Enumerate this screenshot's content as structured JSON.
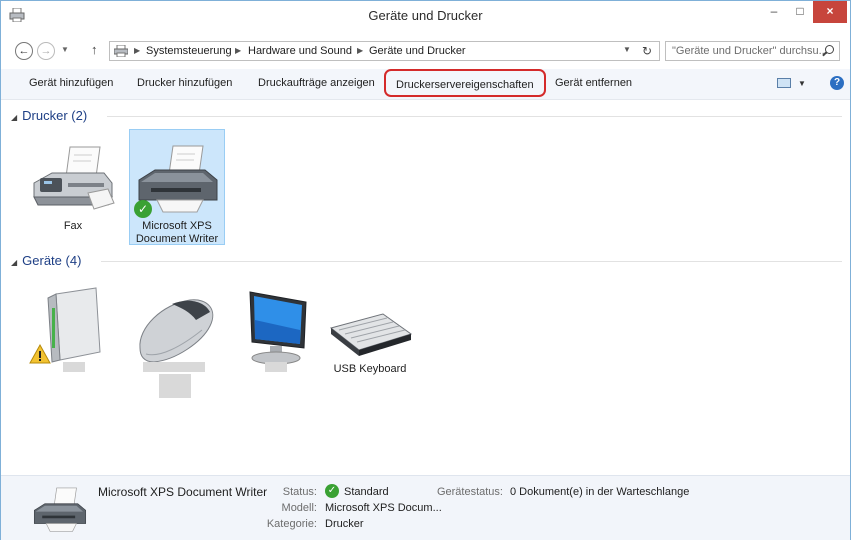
{
  "window": {
    "title": "Geräte und Drucker",
    "minimize": "–",
    "maximize": "□",
    "close": "×"
  },
  "address": {
    "back": "←",
    "forward": "→",
    "up": "↑",
    "breadcrumbs": [
      "Systemsteuerung",
      "Hardware und Sound",
      "Geräte und Drucker"
    ],
    "refresh": "↻",
    "search_placeholder": "\"Geräte und Drucker\" durchsu..."
  },
  "commands": {
    "add_device": "Gerät hinzufügen",
    "add_printer": "Drucker hinzufügen",
    "print_jobs": "Druckaufträge anzeigen",
    "server_properties": "Druckerservereigenschaften",
    "remove_device": "Gerät entfernen",
    "help": "?"
  },
  "groups": {
    "printers_header": "Drucker (2)",
    "devices_header": "Geräte (4)"
  },
  "printers": [
    {
      "label": "Fax"
    },
    {
      "label_line1": "Microsoft XPS",
      "label_line2": "Document Writer",
      "default": true
    }
  ],
  "devices": [
    {
      "label": "",
      "warning": true
    },
    {
      "label": ""
    },
    {
      "label": ""
    },
    {
      "label": "USB Keyboard"
    }
  ],
  "details": {
    "name": "Microsoft XPS Document Writer",
    "status_key": "Status:",
    "status_value": "Standard",
    "model_key": "Modell:",
    "model_value": "Microsoft XPS Docum...",
    "category_key": "Kategorie:",
    "category_value": "Drucker",
    "device_status_key": "Gerätestatus:",
    "device_status_value": "0 Dokument(e) in der Warteschlange"
  },
  "colors": {
    "highlight_border": "#d42a2a",
    "selection_bg": "#cce6fb",
    "group_header": "#1e3f85",
    "close_button": "#c7453c",
    "status_green": "#3aa133"
  }
}
